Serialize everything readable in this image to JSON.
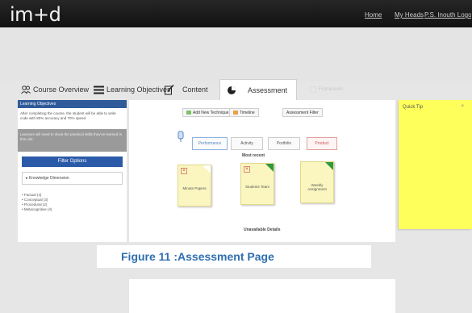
{
  "topbar": {
    "logo": "im+d",
    "links": [
      "Home",
      "My Heads",
      "P.S. Inouth Logout"
    ]
  },
  "tabs": [
    {
      "label": "Course Overview",
      "icon": "people-icon"
    },
    {
      "label": "Learning Objectives",
      "icon": "list-icon"
    },
    {
      "label": "Content",
      "icon": "edit-icon"
    },
    {
      "label": "Assessment",
      "icon": "pie-chart-icon"
    },
    {
      "label": "Framework",
      "icon": "blank-icon"
    }
  ],
  "left_panel": {
    "header": "Learning Objectives",
    "objective_text": "After completing the course, the student will be able to write code with 80% accuracy and 70% speed.",
    "gray_text": "Learners will need to show the practical skills they've learned in this unit.",
    "filter_button": "Filter Options",
    "dropdown": "Knowledge Dimension",
    "list": [
      "Factual (4)",
      "Conceptual (3)",
      "Procedural (2)",
      "Metacognitive (4)"
    ]
  },
  "toolbar": {
    "add_button": "Add New Technique",
    "timeline": "Timeline",
    "assessment_filter": "Assessment Filter"
  },
  "filter_tabs": [
    "Performance",
    "Activity",
    "Portfolio",
    "Product"
  ],
  "sections": {
    "upper": "Most recent",
    "lower": "Unavailable Details"
  },
  "cards": [
    {
      "label": "Minute Papers",
      "corner": "white"
    },
    {
      "label": "Students Team",
      "corner": "green"
    },
    {
      "label": "Weekly Assignment",
      "corner": "green"
    }
  ],
  "sticky_note": {
    "title": "Quick Tip",
    "close": "×"
  },
  "caption": "Figure 11 :Assessment Page",
  "colors": {
    "topbar": "#1a1a1a",
    "accent_blue": "#2f5b9a",
    "card_yellow": "#fbf6bf",
    "sticky_yellow": "#ffff5c",
    "caption_blue": "#2f6fb0",
    "card_corner_green": "#2f9b3c"
  }
}
